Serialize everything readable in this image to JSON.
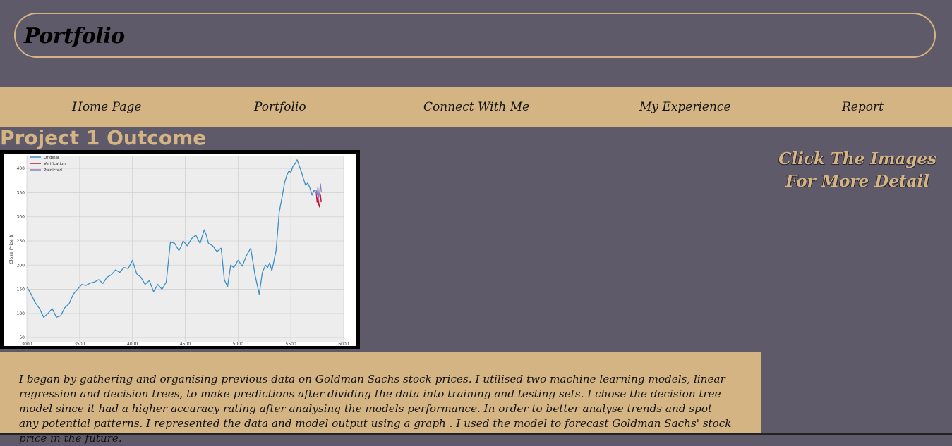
{
  "header": {
    "title": "Portfolio",
    "dash": "-"
  },
  "nav": {
    "items": [
      {
        "label": "Home Page"
      },
      {
        "label": "Portfolio"
      },
      {
        "label": "Connect With Me"
      },
      {
        "label": "My Experience"
      },
      {
        "label": "Report"
      }
    ]
  },
  "main": {
    "section_title": "Project 1 Outcome",
    "hint_line1": "Click The Images",
    "hint_line2": "For More Detail",
    "description": "I began by gathering and organising previous data on Goldman Sachs stock prices. I utilised two machine learning models, linear regression and decision trees, to make predictions after dividing the data into training and testing sets. I chose the decision tree model since it had a higher accuracy rating after analysing the models performance. In order to better analyse trends and spot any potential patterns. I represented the data and model output using a graph . I used the model to forecast Goldman Sachs' stock price in the future."
  },
  "colors": {
    "background": "#5e5a6a",
    "accent": "#d4b483",
    "original": "#3a8fc4",
    "verification": "#c0143c",
    "predicted": "#8a7fc0"
  },
  "chart_data": {
    "type": "line",
    "ylabel": "Close Price $",
    "xlabel": "",
    "xlim": [
      3000,
      6000
    ],
    "ylim": [
      40,
      425
    ],
    "xticks": [
      "3000",
      "3500",
      "4000",
      "4500",
      "5000",
      "5500",
      "6000"
    ],
    "yticks": [
      "50",
      "100",
      "150",
      "200",
      "250",
      "300",
      "350",
      "400"
    ],
    "grid": true,
    "legend_position": "top-left",
    "legend": [
      "Original",
      "Verification",
      "Predicted"
    ],
    "series": [
      {
        "name": "Original",
        "x": [
          3000,
          3040,
          3080,
          3120,
          3160,
          3200,
          3240,
          3280,
          3320,
          3360,
          3400,
          3440,
          3480,
          3520,
          3560,
          3600,
          3640,
          3680,
          3720,
          3760,
          3800,
          3840,
          3880,
          3920,
          3960,
          4000,
          4040,
          4080,
          4120,
          4160,
          4200,
          4240,
          4280,
          4320,
          4360,
          4400,
          4440,
          4460,
          4480,
          4500,
          4520,
          4560,
          4600,
          4640,
          4680,
          4700,
          4720,
          4760,
          4800,
          4840,
          4870,
          4900,
          4930,
          4960,
          5000,
          5040,
          5080,
          5120,
          5160,
          5200,
          5230,
          5260,
          5280,
          5300,
          5320,
          5360,
          5390,
          5420,
          5440,
          5460,
          5480,
          5500,
          5520,
          5540,
          5560,
          5580,
          5600,
          5620,
          5640,
          5660,
          5680,
          5700,
          5720,
          5740
        ],
        "values": [
          155,
          140,
          122,
          110,
          92,
          100,
          110,
          92,
          95,
          112,
          120,
          140,
          150,
          160,
          158,
          163,
          165,
          170,
          162,
          175,
          180,
          190,
          185,
          195,
          193,
          210,
          182,
          175,
          160,
          168,
          145,
          160,
          150,
          165,
          248,
          245,
          230,
          238,
          250,
          245,
          240,
          255,
          262,
          245,
          273,
          262,
          245,
          240,
          228,
          235,
          170,
          155,
          200,
          195,
          210,
          198,
          220,
          235,
          180,
          140,
          185,
          200,
          195,
          205,
          188,
          230,
          310,
          345,
          370,
          385,
          395,
          392,
          405,
          410,
          418,
          405,
          393,
          378,
          365,
          370,
          360,
          345,
          355,
          350
        ]
      },
      {
        "name": "Verification",
        "x": [
          5740,
          5748,
          5756,
          5764,
          5772,
          5780,
          5788
        ],
        "values": [
          350,
          330,
          342,
          325,
          320,
          345,
          330
        ]
      },
      {
        "name": "Predicted",
        "x": [
          5740,
          5748,
          5756,
          5764,
          5772,
          5780,
          5788
        ],
        "values": [
          355,
          345,
          362,
          340,
          350,
          368,
          352
        ]
      }
    ]
  }
}
